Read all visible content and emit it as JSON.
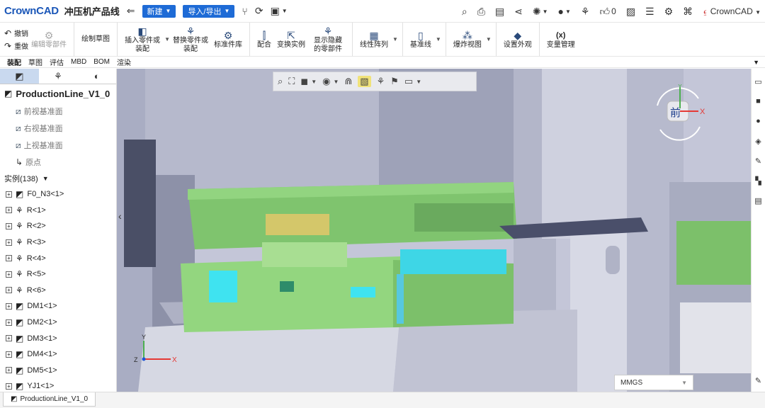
{
  "app": {
    "logo": "CrownCAD",
    "doc_title": "冲压机产品线"
  },
  "titlebar": {
    "new_label": "新建",
    "importexport_label": "导入/导出",
    "likes": "0",
    "user": "CrownCAD"
  },
  "ribbon": {
    "undo": "撤销",
    "redo": "重做",
    "edit_part": "编辑零部件",
    "sketch": "绘制草图",
    "insert_part": "插入零件或装配",
    "replace_part": "替换零件或装配",
    "std_lib": "标准件库",
    "mate": "配合",
    "transform": "变换实例",
    "show_hidden": "显示隐藏的零部件",
    "linear_pattern": "线性阵列",
    "datum_line": "基准线",
    "exploded_view": "爆炸视图",
    "appearance": "设置外观",
    "var_mgr_icon": "(x)",
    "var_mgr": "变量管理"
  },
  "tabs": [
    "装配",
    "草图",
    "评估",
    "MBD",
    "BOM",
    "渲染"
  ],
  "tree": {
    "root": "ProductionLine_V1_0",
    "planes": [
      "前视基准面",
      "右视基准面",
      "上视基准面",
      "原点"
    ],
    "instances_label": "实例(138)",
    "items": [
      "F0_N3<1>",
      "R<1>",
      "R<2>",
      "R<3>",
      "R<4>",
      "R<5>",
      "R<6>",
      "DM1<1>",
      "DM2<1>",
      "DM3<1>",
      "DM4<1>",
      "DM5<1>",
      "YJ1<1>"
    ]
  },
  "viewport": {
    "cube_face": "前",
    "axis_x": "X",
    "axis_y": "Y",
    "axis_z": "Z",
    "units": "MMGS"
  },
  "bottom_tab": "ProductionLine_V1_0",
  "colors": {
    "brand": "#1b57b8",
    "button_blue": "#1e6bd6",
    "machine_gray": "#b8bbd0",
    "die_green": "#8fd37a",
    "cyan": "#3fe3f0",
    "yellow_highlight": "#f0e27a"
  }
}
